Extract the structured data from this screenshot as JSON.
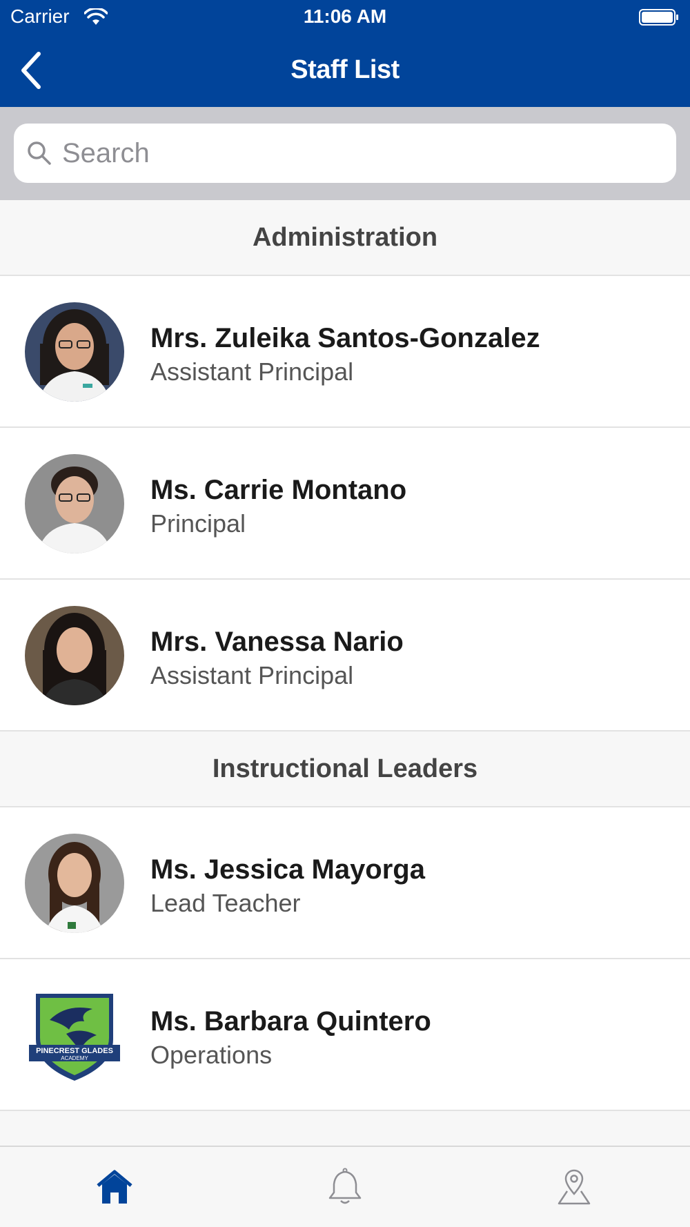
{
  "status_bar": {
    "carrier": "Carrier",
    "time": "11:06 AM"
  },
  "nav": {
    "title": "Staff List",
    "back_icon": "chevron-left-icon"
  },
  "search": {
    "placeholder": "Search",
    "value": "",
    "icon": "search-icon"
  },
  "sections": [
    {
      "title": "Administration",
      "staff": [
        {
          "name": "Mrs. Zuleika Santos-Gonzalez",
          "title": "Assistant Principal"
        },
        {
          "name": "Ms. Carrie Montano",
          "title": "Principal"
        },
        {
          "name": "Mrs. Vanessa Nario",
          "title": "Assistant Principal"
        }
      ]
    },
    {
      "title": "Instructional Leaders",
      "staff": [
        {
          "name": "Ms. Jessica Mayorga",
          "title": "Lead Teacher"
        },
        {
          "name": "Ms. Barbara Quintero",
          "title": "Operations"
        }
      ]
    }
  ],
  "tabs": [
    {
      "icon": "home-icon",
      "active": true
    },
    {
      "icon": "bell-icon",
      "active": false
    },
    {
      "icon": "map-pin-icon",
      "active": false
    }
  ],
  "colors": {
    "brand": "#01449A",
    "search_bg": "#C9C9CE",
    "section_bg": "#F7F7F7",
    "tab_inactive": "#8E8E93"
  },
  "logo": {
    "text_line1": "PINECREST GLADES",
    "text_line2": "ACADEMY"
  }
}
